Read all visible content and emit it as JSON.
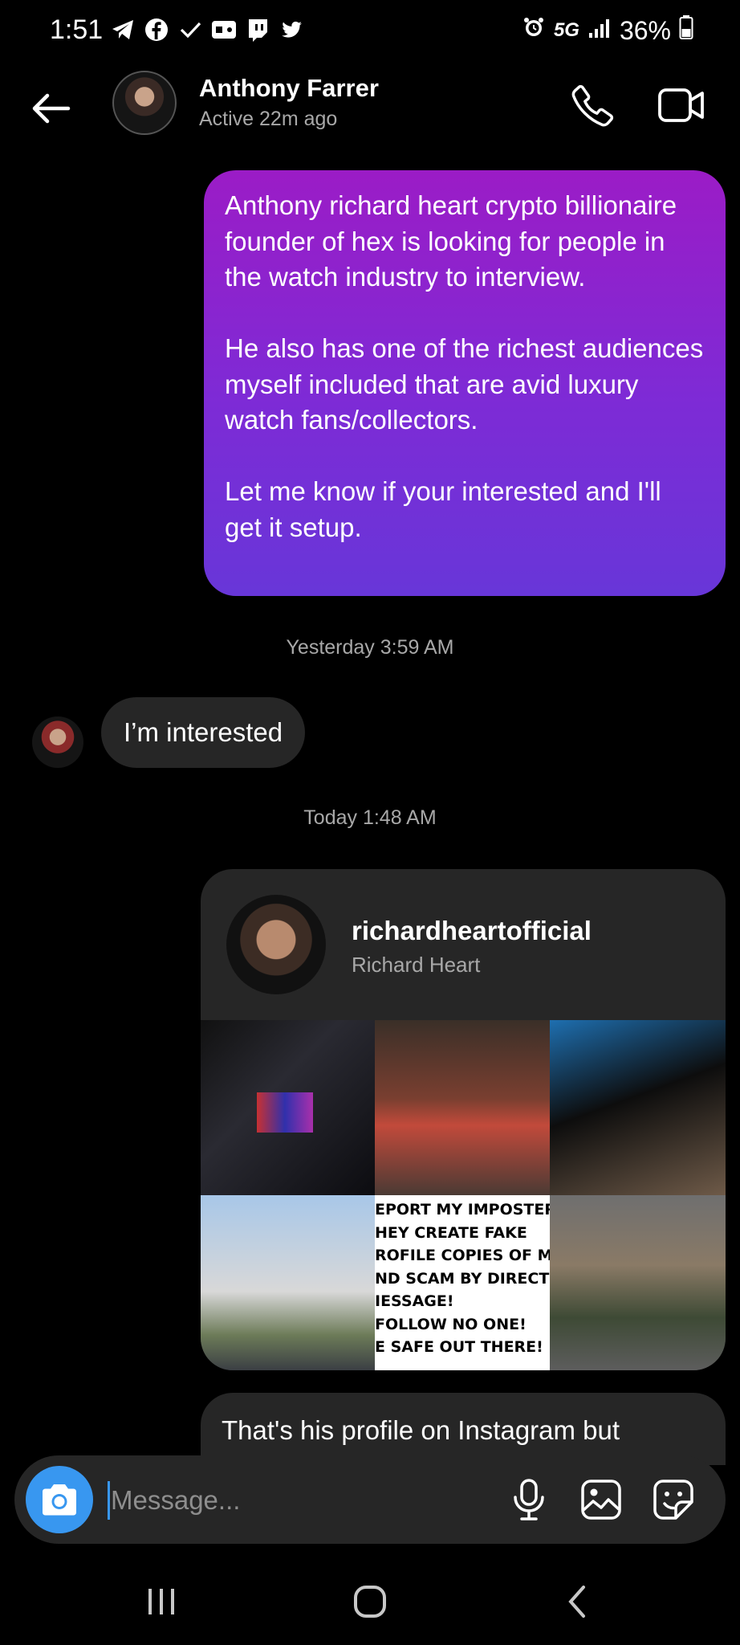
{
  "status_bar": {
    "time": "1:51",
    "network": "5G",
    "battery": "36%",
    "left_icons": [
      "telegram-icon",
      "facebook-icon",
      "check-icon",
      "game-icon",
      "twitch-icon",
      "twitter-icon"
    ],
    "right_icons": [
      "alarm-icon",
      "signal-icon",
      "battery-icon"
    ]
  },
  "header": {
    "name": "Anthony Farrer",
    "status": "Active 22m ago",
    "icons": [
      "back-arrow-icon",
      "phone-icon",
      "video-camera-icon"
    ]
  },
  "messages": {
    "outgoing_1": "Anthony richard heart crypto billionaire founder of hex is looking for people in the watch industry to interview.\n\nHe also has one of the richest audiences myself included that are avid luxury watch fans/collectors.\n\nLet me know if your interested and I'll get it setup.",
    "timestamp_1": "Yesterday 3:59 AM",
    "incoming_1": "I’m interested",
    "timestamp_2": "Today 1:48 AM",
    "shared_profile": {
      "username": "richardheartofficial",
      "full_name": "Richard Heart",
      "notice_text": "EPORT MY IMPOSTERS\nHEY CREATE FAKE\nROFILE COPIES OF ME\nND SCAM BY DIRECT\nIESSAGE!\nFOLLOW NO ONE!\nE SAFE OUT THERE!"
    },
    "outgoing_2": "That's his profile on Instagram but"
  },
  "composer": {
    "placeholder": "Message...",
    "icons": [
      "camera-icon",
      "microphone-icon",
      "gallery-icon",
      "sticker-icon"
    ],
    "accent_color": "#3897f0"
  },
  "nav_bar": {
    "icons": [
      "recent-apps-icon",
      "home-icon",
      "back-icon"
    ]
  },
  "colors": {
    "background": "#000000",
    "incoming_bubble": "#262626",
    "outgoing_gradient_top": "#9b1cc6",
    "outgoing_gradient_bottom": "#6836d8",
    "secondary_text": "#a8a8a8"
  }
}
